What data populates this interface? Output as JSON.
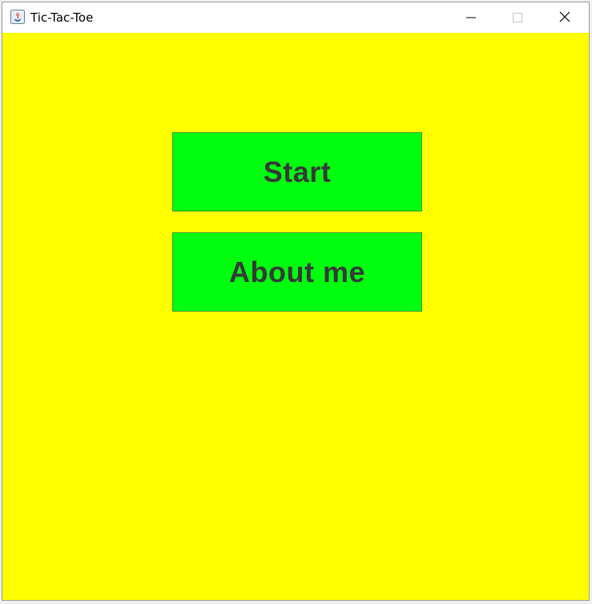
{
  "window": {
    "title": "Tic-Tac-Toe",
    "controls": {
      "minimize": "minimize-icon",
      "maximize": "maximize-icon",
      "close": "close-icon"
    }
  },
  "menu": {
    "start_label": "Start",
    "about_label": "About me"
  },
  "colors": {
    "background": "#ffff00",
    "button_fill": "#00ff0f",
    "button_text": "#383838"
  }
}
